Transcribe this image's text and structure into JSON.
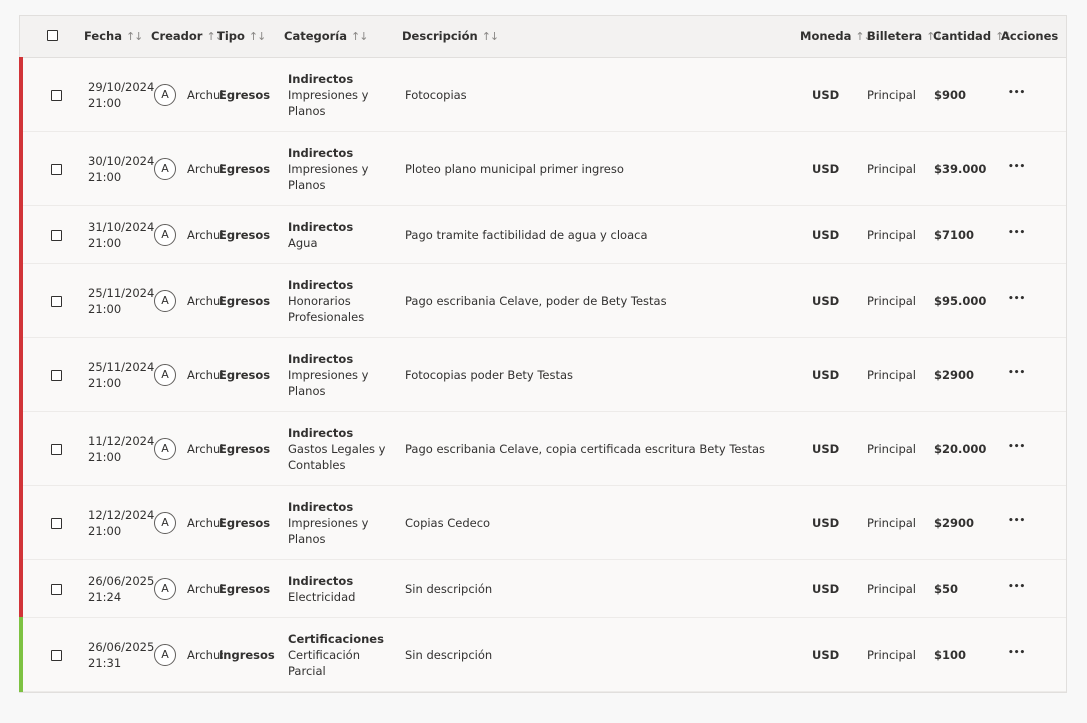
{
  "columns": {
    "fecha": "Fecha",
    "creador": "Creador",
    "tipo": "Tipo",
    "categoria": "Categoría",
    "descripcion": "Descripción",
    "moneda": "Moneda",
    "billetera": "Billetera",
    "cantidad": "Cantidad",
    "acciones": "Acciones"
  },
  "sort_glyph": "↑↓",
  "colors": {
    "egresos": "#d13438",
    "ingresos": "#7dc242"
  },
  "rows": [
    {
      "date": "29/10/2024",
      "time": "21:00",
      "avatar": "A",
      "creator": "Archuby",
      "type": "Egresos",
      "kind": "egresos",
      "cat_main": "Indirectos",
      "cat_sub": [
        "Impresiones y",
        "Planos"
      ],
      "desc": "Fotocopias",
      "currency": "USD",
      "wallet": "Principal",
      "amount": "$900"
    },
    {
      "date": "30/10/2024",
      "time": "21:00",
      "avatar": "A",
      "creator": "Archuby",
      "type": "Egresos",
      "kind": "egresos",
      "cat_main": "Indirectos",
      "cat_sub": [
        "Impresiones y",
        "Planos"
      ],
      "desc": "Ploteo plano municipal primer ingreso",
      "currency": "USD",
      "wallet": "Principal",
      "amount": "$39.000"
    },
    {
      "date": "31/10/2024",
      "time": "21:00",
      "avatar": "A",
      "creator": "Archuby",
      "type": "Egresos",
      "kind": "egresos",
      "cat_main": "Indirectos",
      "cat_sub": [
        "Agua"
      ],
      "desc": "Pago tramite factibilidad de agua y cloaca",
      "currency": "USD",
      "wallet": "Principal",
      "amount": "$7100"
    },
    {
      "date": "25/11/2024",
      "time": "21:00",
      "avatar": "A",
      "creator": "Archuby",
      "type": "Egresos",
      "kind": "egresos",
      "cat_main": "Indirectos",
      "cat_sub": [
        "Honorarios",
        "Profesionales"
      ],
      "desc": "Pago escribania Celave, poder de Bety Testas",
      "currency": "USD",
      "wallet": "Principal",
      "amount": "$95.000"
    },
    {
      "date": "25/11/2024",
      "time": "21:00",
      "avatar": "A",
      "creator": "Archuby",
      "type": "Egresos",
      "kind": "egresos",
      "cat_main": "Indirectos",
      "cat_sub": [
        "Impresiones y",
        "Planos"
      ],
      "desc": "Fotocopias poder Bety Testas",
      "currency": "USD",
      "wallet": "Principal",
      "amount": "$2900"
    },
    {
      "date": "11/12/2024",
      "time": "21:00",
      "avatar": "A",
      "creator": "Archuby",
      "type": "Egresos",
      "kind": "egresos",
      "cat_main": "Indirectos",
      "cat_sub": [
        "Gastos Legales y",
        "Contables"
      ],
      "desc": "Pago escribania Celave, copia certificada escritura Bety Testas",
      "currency": "USD",
      "wallet": "Principal",
      "amount": "$20.000"
    },
    {
      "date": "12/12/2024",
      "time": "21:00",
      "avatar": "A",
      "creator": "Archuby",
      "type": "Egresos",
      "kind": "egresos",
      "cat_main": "Indirectos",
      "cat_sub": [
        "Impresiones y",
        "Planos"
      ],
      "desc": "Copias Cedeco",
      "currency": "USD",
      "wallet": "Principal",
      "amount": "$2900"
    },
    {
      "date": "26/06/2025",
      "time": "21:24",
      "avatar": "A",
      "creator": "Archuby",
      "type": "Egresos",
      "kind": "egresos",
      "cat_main": "Indirectos",
      "cat_sub": [
        "Electricidad"
      ],
      "desc": "Sin descripción",
      "currency": "USD",
      "wallet": "Principal",
      "amount": "$50"
    },
    {
      "date": "26/06/2025",
      "time": "21:31",
      "avatar": "A",
      "creator": "Archuby",
      "type": "Ingresos",
      "kind": "ingresos",
      "cat_main": "Certificaciones",
      "cat_sub": [
        "Certificación",
        "Parcial"
      ],
      "desc": "Sin descripción",
      "currency": "USD",
      "wallet": "Principal",
      "amount": "$100"
    }
  ],
  "actions_glyph": "•••"
}
